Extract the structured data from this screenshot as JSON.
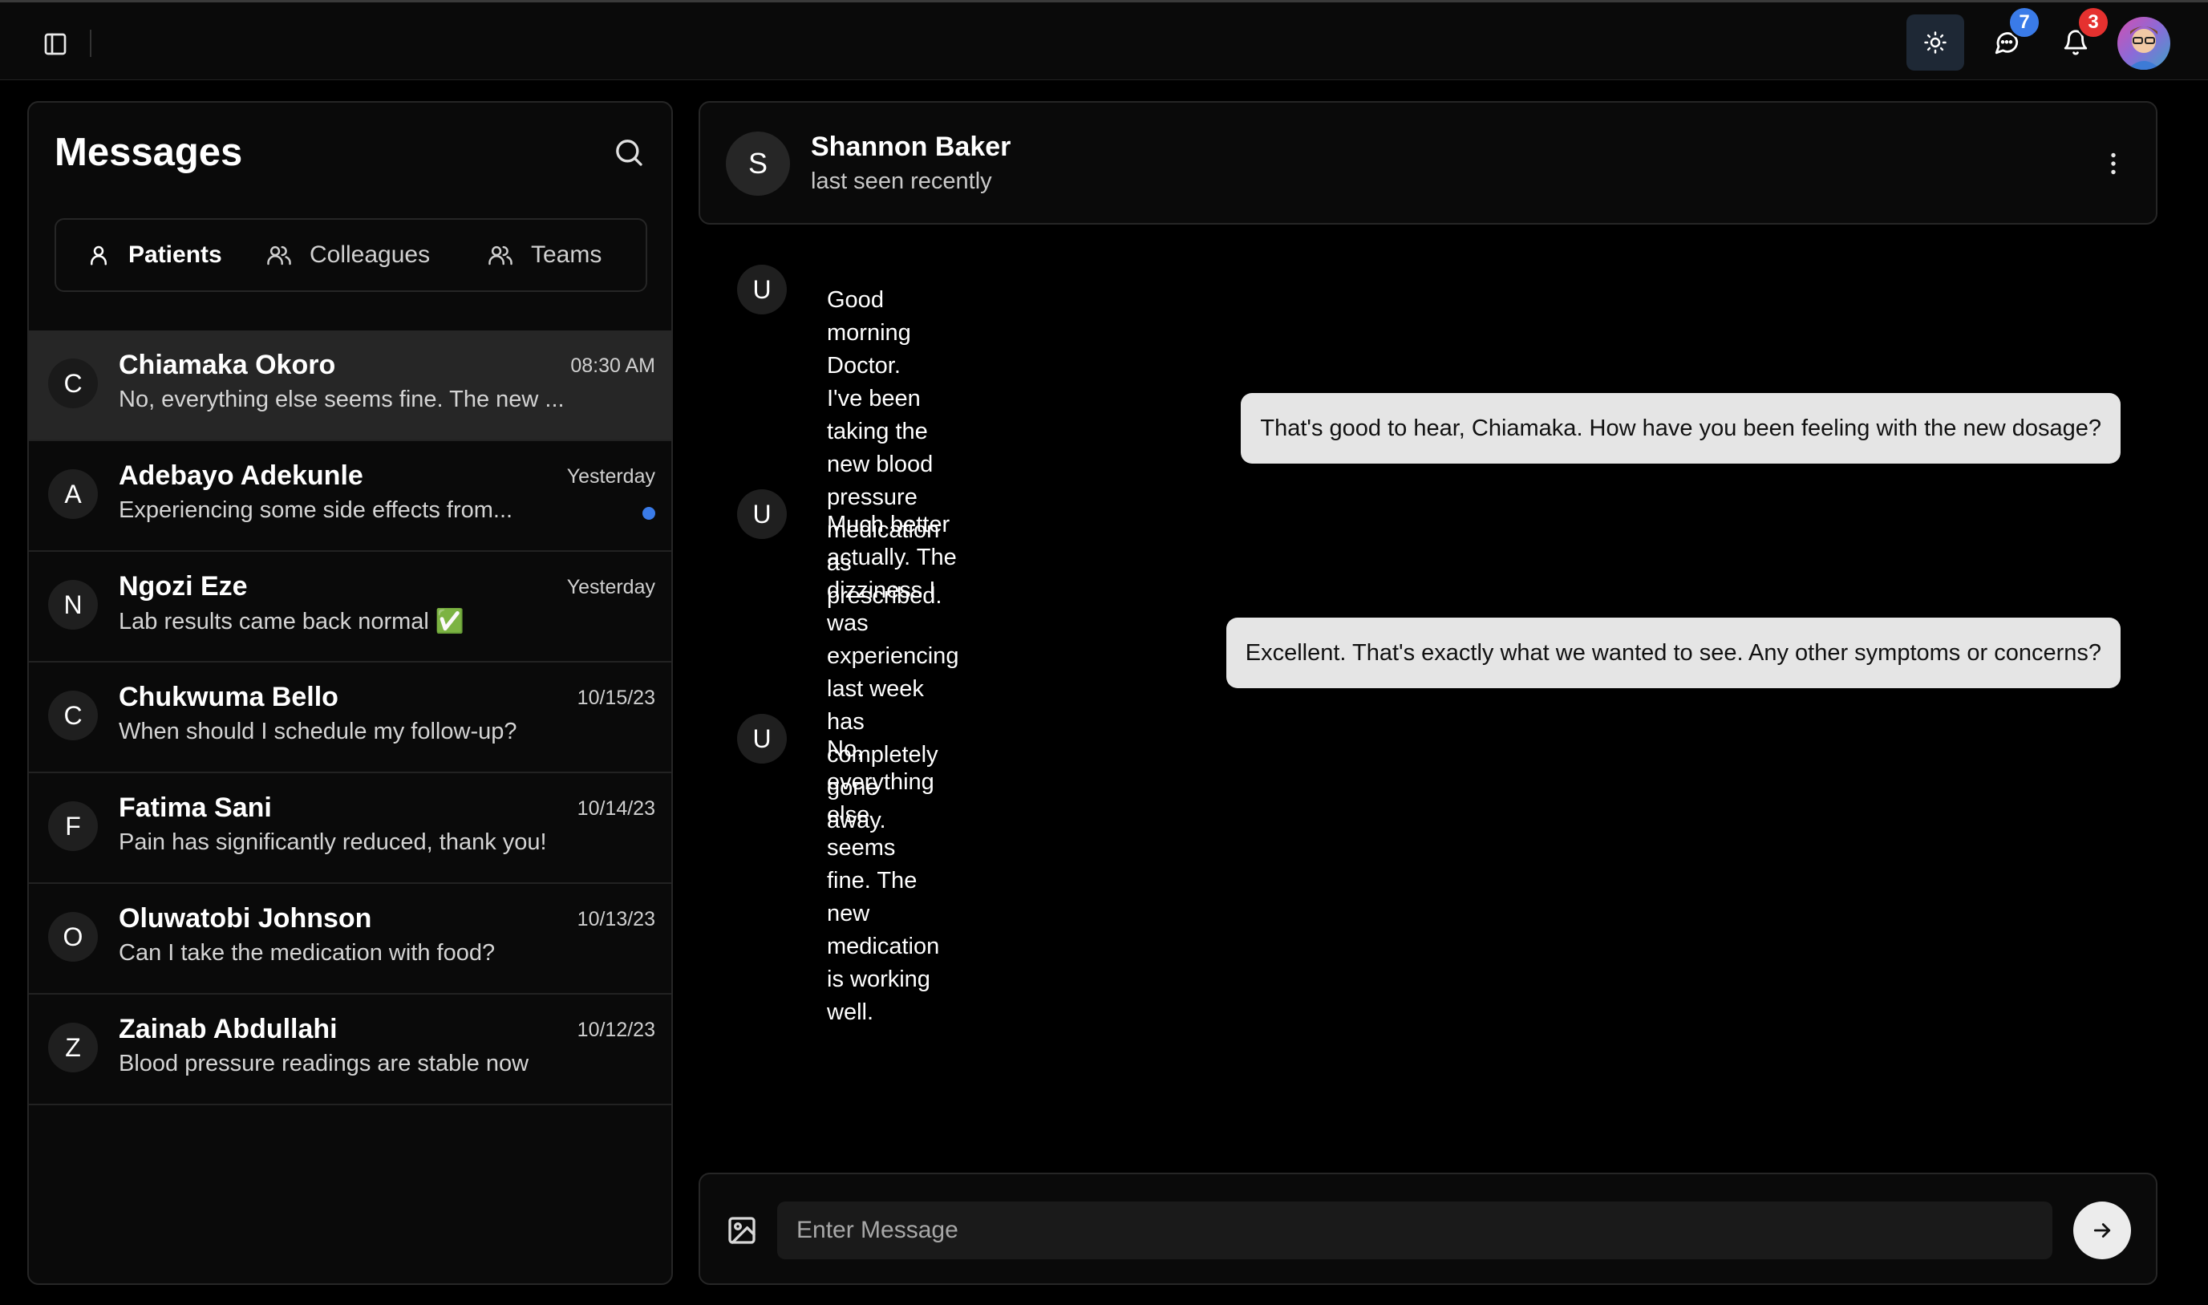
{
  "topbar": {
    "messages_badge": "7",
    "notifications_badge": "3",
    "icons": [
      "sidebar-toggle-icon",
      "sun-icon",
      "chat-bubble-icon",
      "bell-icon",
      "avatar"
    ],
    "colors": {
      "badge_blue": "#3a7be8",
      "badge_red": "#e5312f",
      "theme_button_bg": "#1e2835"
    }
  },
  "sidebar": {
    "title": "Messages",
    "tabs": [
      {
        "label": "Patients",
        "active": true
      },
      {
        "label": "Colleagues",
        "active": false
      },
      {
        "label": "Teams",
        "active": false
      }
    ],
    "conversations": [
      {
        "initial": "C",
        "name": "Chiamaka Okoro",
        "time": "08:30 AM",
        "preview": "No, everything else seems fine. The new ...",
        "active": true,
        "unread": false
      },
      {
        "initial": "A",
        "name": "Adebayo Adekunle",
        "time": "Yesterday",
        "preview": "Experiencing some side effects from...",
        "active": false,
        "unread": true
      },
      {
        "initial": "N",
        "name": "Ngozi Eze",
        "time": "Yesterday",
        "preview": "Lab results came back normal ✅",
        "active": false,
        "unread": false
      },
      {
        "initial": "C",
        "name": "Chukwuma Bello",
        "time": "10/15/23",
        "preview": "When should I schedule my follow-up?",
        "active": false,
        "unread": false
      },
      {
        "initial": "F",
        "name": "Fatima Sani",
        "time": "10/14/23",
        "preview": "Pain has significantly reduced, thank you!",
        "active": false,
        "unread": false
      },
      {
        "initial": "O",
        "name": "Oluwatobi Johnson",
        "time": "10/13/23",
        "preview": "Can I take the medication with food?",
        "active": false,
        "unread": false
      },
      {
        "initial": "Z",
        "name": "Zainab Abdullahi",
        "time": "10/12/23",
        "preview": "Blood pressure readings are stable now",
        "active": false,
        "unread": false
      }
    ]
  },
  "chat": {
    "contact_initial": "S",
    "contact_name": "Shannon Baker",
    "contact_status": "last seen recently",
    "messages": [
      {
        "from": "patient",
        "initial": "U",
        "lines": [
          "Good morning Doctor. I've been taking the new blood pressure medication as",
          "prescribed."
        ]
      },
      {
        "from": "doctor",
        "text": "That's good to hear, Chiamaka. How have you been feeling with the new dosage?"
      },
      {
        "from": "patient",
        "initial": "U",
        "lines": [
          "Much better actually. The dizziness I was experiencing last week has completely gone",
          "away."
        ]
      },
      {
        "from": "doctor",
        "text": "Excellent. That's exactly what we wanted to see. Any other symptoms or concerns?"
      },
      {
        "from": "patient",
        "initial": "U",
        "lines": [
          "No, everything else seems fine. The new medication is working well."
        ]
      }
    ],
    "composer": {
      "placeholder": "Enter Message",
      "value": ""
    }
  }
}
